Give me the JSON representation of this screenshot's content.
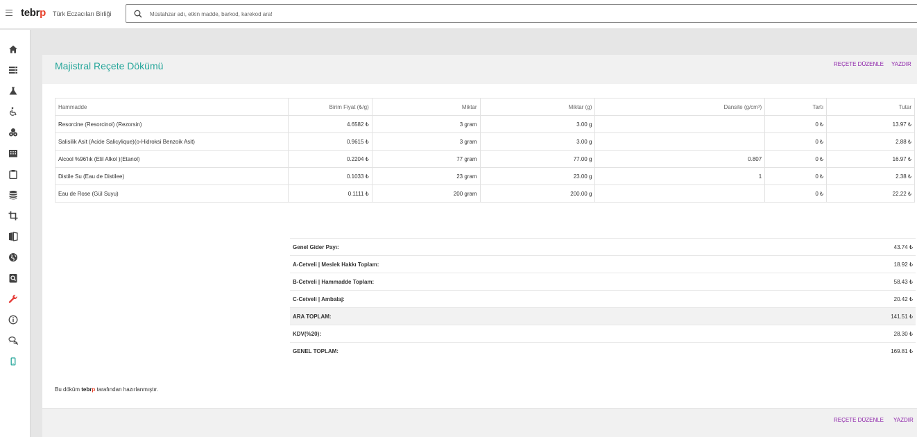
{
  "topbar": {
    "logo_main": "tebr",
    "logo_accent": "p",
    "org_name": "Türk Eczacıları Birliği",
    "search_placeholder": "Müstahzar adı, etkin madde, barkod, karekod ara!"
  },
  "sidebar": {
    "icons": [
      "home-icon",
      "list-icon",
      "flask-icon",
      "wheelchair-icon",
      "pills-icon",
      "building-icon",
      "clipboard-icon",
      "database-icon",
      "crop-icon",
      "book-icon",
      "globe-icon",
      "search-doc-icon",
      "wrench-icon",
      "info-icon",
      "chat-icon",
      "mobile-icon"
    ]
  },
  "page": {
    "title": "Majistral Reçete Dökümü",
    "edit_label": "REÇETE DÜZENLE",
    "print_label": "YAZDIR"
  },
  "table": {
    "headers": [
      "Hammadde",
      "Birim Fiyat (₺/g)",
      "Miktar",
      "Miktar (g)",
      "Dansite (g/cm³)",
      "Tartı",
      "Tutar"
    ],
    "rows": [
      [
        "Resorcine (Resorcinol) (Rezorsin)",
        "4.6582 ₺",
        "3 gram",
        "3.00 g",
        "",
        "0 ₺",
        "13.97 ₺"
      ],
      [
        "Salisilik Asit (Acide Salicylique)(o-Hidroksi Benzoik Asit)",
        "0.9615 ₺",
        "3 gram",
        "3.00 g",
        "",
        "0 ₺",
        "2.88 ₺"
      ],
      [
        "Alcool %96'lık (Etil Alkol )(Etanol)",
        "0.2204 ₺",
        "77 gram",
        "77.00 g",
        "0.807",
        "0 ₺",
        "16.97 ₺"
      ],
      [
        "Distile Su (Eau de Distilee)",
        "0.1033 ₺",
        "23 gram",
        "23.00 g",
        "1",
        "0 ₺",
        "2.38 ₺"
      ],
      [
        "Eau de Rose (Gül Suyu)",
        "0.1111 ₺",
        "200 gram",
        "200.00 g",
        "",
        "0 ₺",
        "22.22 ₺"
      ]
    ]
  },
  "totals": [
    {
      "label": "Genel Gider Payı:",
      "value": "43.74 ₺"
    },
    {
      "label": "A-Cetveli | Meslek Hakkı Toplam:",
      "value": "18.92 ₺"
    },
    {
      "label": "B-Cetveli | Hammadde Toplam:",
      "value": "58.43 ₺"
    },
    {
      "label": "C-Cetveli | Ambalaj:",
      "value": "20.42 ₺"
    },
    {
      "label": "ARA TOPLAM:",
      "value": "141.51 ₺"
    },
    {
      "label": "KDV(%20):",
      "value": "28.30 ₺"
    },
    {
      "label": "GENEL TOPLAM:",
      "value": "169.81 ₺"
    }
  ],
  "footnote": {
    "prefix": "Bu döküm ",
    "brand_main": "tebr",
    "brand_accent": "p",
    "suffix": " tarafından hazırlanmıştır."
  },
  "colors": {
    "title": "#26a69a",
    "link": "#8e24aa",
    "logo_accent": "#e8402a",
    "icon": "#424242",
    "icon_wrench": "#e53935",
    "icon_mobile": "#26a69a"
  }
}
